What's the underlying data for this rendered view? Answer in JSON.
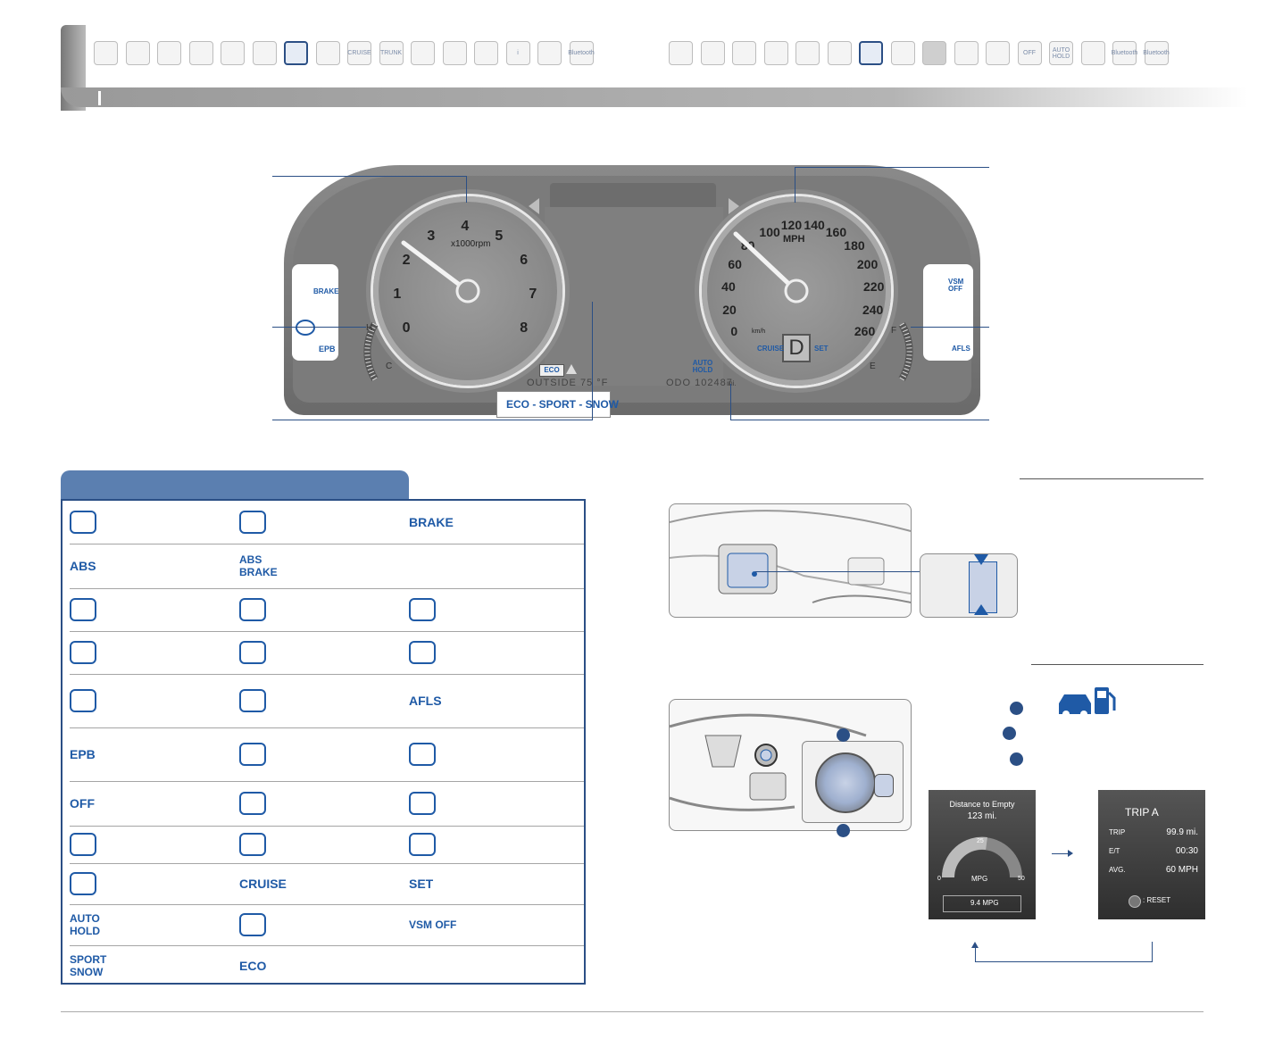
{
  "top_tabs_left": [
    "",
    "",
    "",
    "",
    "",
    "",
    "",
    "",
    "CRUISE",
    "TRUNK",
    "",
    "",
    "",
    "i",
    "",
    "Bluetooth"
  ],
  "top_tabs_right": [
    "",
    "",
    "",
    "",
    "",
    "",
    "",
    "",
    "",
    "",
    "",
    "OFF",
    "AUTO HOLD",
    "",
    "Bluetooth",
    "Bluetooth"
  ],
  "cluster": {
    "tach_numbers": [
      "0",
      "1",
      "2",
      "3",
      "4",
      "5",
      "6",
      "7",
      "8"
    ],
    "tach_unit": "x1000rpm",
    "speed_numbers": [
      "0",
      "20",
      "40",
      "60",
      "80",
      "100",
      "120",
      "140",
      "160",
      "180",
      "200",
      "220",
      "240",
      "260"
    ],
    "speed_unit": "MPH",
    "kmh_numbers": [
      "20",
      "40",
      "60",
      "80",
      "100",
      "120",
      "140",
      "160",
      "180",
      "200",
      "220",
      "240",
      "260"
    ],
    "kmh_unit": "km/h",
    "gear": "D",
    "cruise": "CRUISE",
    "set": "SET",
    "auto_hold": "AUTO HOLD",
    "outside": "OUTSIDE  75 °F",
    "odo": "ODO  102487",
    "odo_unit": "mi.",
    "eco_badge": "ECO",
    "modes": "ECO - SPORT - SNOW",
    "temp_h": "H",
    "temp_c": "C",
    "fuel_f": "F",
    "fuel_e": "E",
    "left_panel": {
      "brake": "BRAKE",
      "epb": "EPB"
    },
    "right_panel": {
      "vsm": "VSM OFF",
      "afls": "AFLS"
    }
  },
  "legend": {
    "header": "",
    "rows": [
      [
        "airbag",
        "seatbelt",
        "BRAKE"
      ],
      [
        "ABS",
        "ABS BRAKE",
        ""
      ],
      [
        "engine",
        "battery",
        "coolant"
      ],
      [
        "oil",
        "fuel",
        "tpms"
      ],
      [
        "door",
        "trunk",
        "AFLS"
      ],
      [
        "EPB",
        "warning",
        "esc"
      ],
      [
        "OFF",
        "auto-light",
        "hood"
      ],
      [
        "turn",
        "high-beam",
        "tail-light"
      ],
      [
        "fog",
        "CRUISE",
        "SET"
      ],
      [
        "AUTO HOLD",
        "lane",
        "VSM OFF"
      ],
      [
        "SPORT SNOW",
        "ECO",
        ""
      ]
    ]
  },
  "dte_screen": {
    "title": "Distance to Empty",
    "value": "123 mi.",
    "gauge_mid": "25",
    "gauge_min": "0",
    "gauge_max": "50",
    "gauge_label": "MPG",
    "footer": "9.4 MPG"
  },
  "trip_screen": {
    "title": "TRIP A",
    "rows": [
      {
        "label": "TRIP",
        "value": "99.9 mi."
      },
      {
        "label": "E/T",
        "value": "00:30"
      },
      {
        "label": "AVG.",
        "value": "60 MPH"
      }
    ],
    "reset": ": RESET"
  }
}
